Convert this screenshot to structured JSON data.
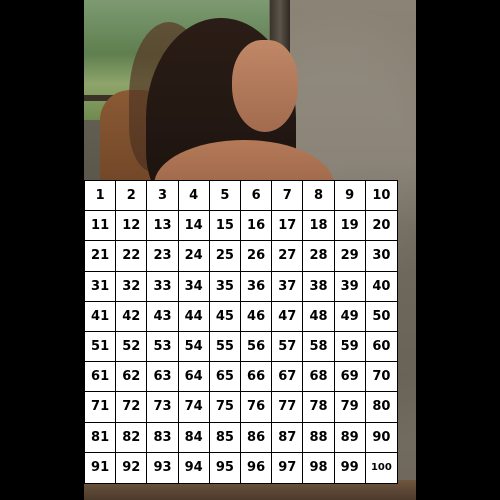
{
  "grid": {
    "columns": 10,
    "rows": 10,
    "cells": [
      "1",
      "2",
      "3",
      "4",
      "5",
      "6",
      "7",
      "8",
      "9",
      "10",
      "11",
      "12",
      "13",
      "14",
      "15",
      "16",
      "17",
      "18",
      "19",
      "20",
      "21",
      "22",
      "23",
      "24",
      "25",
      "26",
      "27",
      "28",
      "29",
      "30",
      "31",
      "32",
      "33",
      "34",
      "35",
      "36",
      "37",
      "38",
      "39",
      "40",
      "41",
      "42",
      "43",
      "44",
      "45",
      "46",
      "47",
      "48",
      "49",
      "50",
      "51",
      "52",
      "53",
      "54",
      "55",
      "56",
      "57",
      "58",
      "59",
      "60",
      "61",
      "62",
      "63",
      "64",
      "65",
      "66",
      "67",
      "68",
      "69",
      "70",
      "71",
      "72",
      "73",
      "74",
      "75",
      "76",
      "77",
      "78",
      "79",
      "80",
      "81",
      "82",
      "83",
      "84",
      "85",
      "86",
      "87",
      "88",
      "89",
      "90",
      "91",
      "92",
      "93",
      "94",
      "95",
      "96",
      "97",
      "98",
      "99",
      "100"
    ]
  },
  "colors": {
    "background": "#000000",
    "cell_fill": "#ffffff",
    "cell_border": "#000000",
    "cell_text": "#000000"
  }
}
